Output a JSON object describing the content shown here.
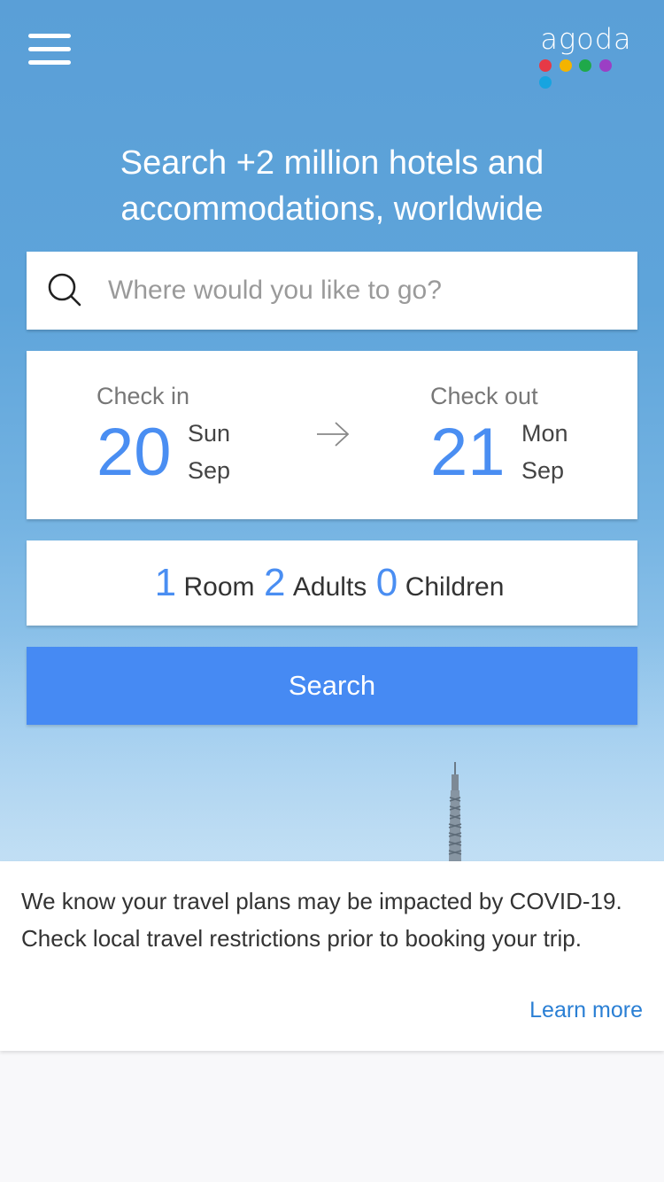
{
  "header": {
    "logo_text": "agoda",
    "logo_dot_colors": [
      "#e63946",
      "#f4b400",
      "#1fa94a",
      "#9b3fc4",
      "#17a4e0"
    ],
    "menu_icon": "hamburger-menu-icon"
  },
  "headline": "Search +2 million hotels and accommodations, worldwide",
  "search": {
    "placeholder": "Where would you like to go?",
    "value": "",
    "icon": "search-icon"
  },
  "dates": {
    "check_in": {
      "label": "Check in",
      "day": "20",
      "weekday": "Sun",
      "month": "Sep"
    },
    "check_out": {
      "label": "Check out",
      "day": "21",
      "weekday": "Mon",
      "month": "Sep"
    },
    "arrow_icon": "arrow-right-icon"
  },
  "guests": {
    "rooms": "1",
    "rooms_label": "Room",
    "adults": "2",
    "adults_label": "Adults",
    "children": "0",
    "children_label": "Children"
  },
  "search_button": "Search",
  "notice": {
    "text": "We know your travel plans may be impacted by COVID-19. Check local travel restrictions prior to booking your trip.",
    "link": "Learn more"
  },
  "colors": {
    "accent": "#4a8ef2",
    "button": "#468af3",
    "link": "#2a7fd4",
    "sky": "#5ea4da"
  }
}
